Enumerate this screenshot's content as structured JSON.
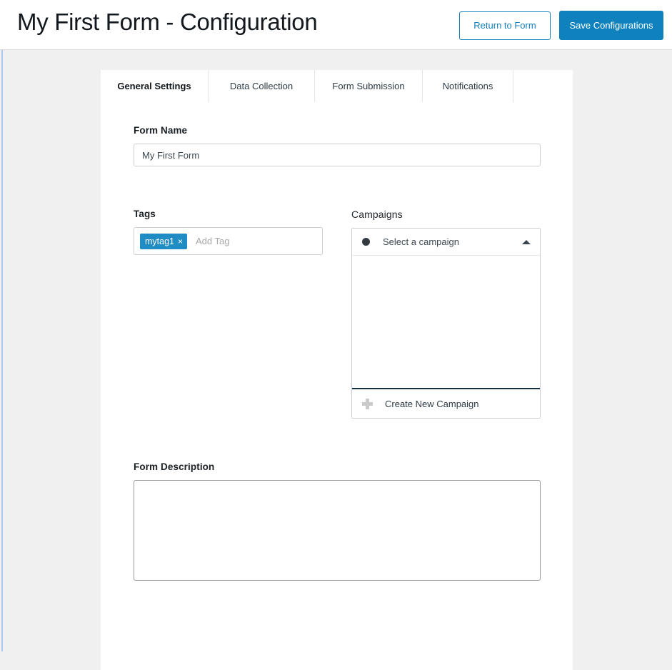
{
  "header": {
    "title": "My First Form - Configuration",
    "return_button_label": "Return to Form",
    "save_button_label": "Save Configurations"
  },
  "tabs": [
    {
      "id": "general-settings",
      "label": "General Settings",
      "active": true
    },
    {
      "id": "data-collection",
      "label": "Data Collection",
      "active": false
    },
    {
      "id": "form-submission",
      "label": "Form Submission",
      "active": false
    },
    {
      "id": "notifications",
      "label": "Notifications",
      "active": false
    }
  ],
  "general_settings": {
    "form_name": {
      "label": "Form Name",
      "value": "My First Form",
      "placeholder": "Form Name"
    },
    "tags": {
      "label": "Tags",
      "chips": [
        {
          "label": "mytag1",
          "remove_icon": "×"
        }
      ],
      "add_tag_placeholder": "Add Tag",
      "add_tag_value": ""
    },
    "campaigns": {
      "label": "Campaigns",
      "selected_value": "Select a campaign",
      "options": [],
      "expanded": true,
      "chevron_state": "up",
      "create_new_label": "Create New Campaign"
    },
    "form_description": {
      "label": "Form Description",
      "value": "",
      "placeholder": ""
    }
  },
  "colors": {
    "accent_blue": "#0f81bd",
    "link_blue": "#1381bd",
    "tag_blue": "#1f8cc4",
    "page_background": "#f0f0f0",
    "card_background": "#ffffff",
    "divider_dark": "#17303f"
  }
}
